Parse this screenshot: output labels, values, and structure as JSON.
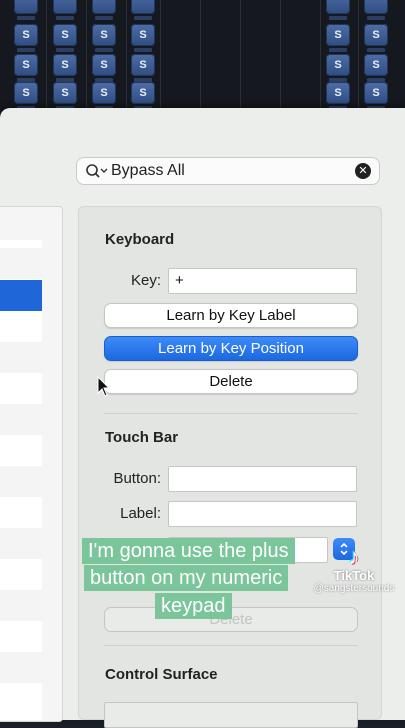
{
  "mixer": {
    "solo_label": "S"
  },
  "search": {
    "value": "Bypass All"
  },
  "keyboard": {
    "title": "Keyboard",
    "key_label": "Key:",
    "key_value": "+",
    "learn_label_button": "Learn by Key Label",
    "learn_position_button": "Learn by Key Position",
    "delete_button": "Delete"
  },
  "touch_bar": {
    "title": "Touch Bar",
    "button_label": "Button:",
    "label_label": "Label:",
    "button_value": "",
    "label_value": "",
    "delete_button": "Delete"
  },
  "control_surface": {
    "title": "Control Surface"
  },
  "caption": {
    "line1": "I'm gonna use the plus",
    "line2": "button on my numeric",
    "line3": "keypad"
  },
  "watermark": {
    "name": "TikTok",
    "handle": "@sangstersounds"
  },
  "colors": {
    "accent": "#1f66d8",
    "caption_bg": "#7bc59a"
  }
}
